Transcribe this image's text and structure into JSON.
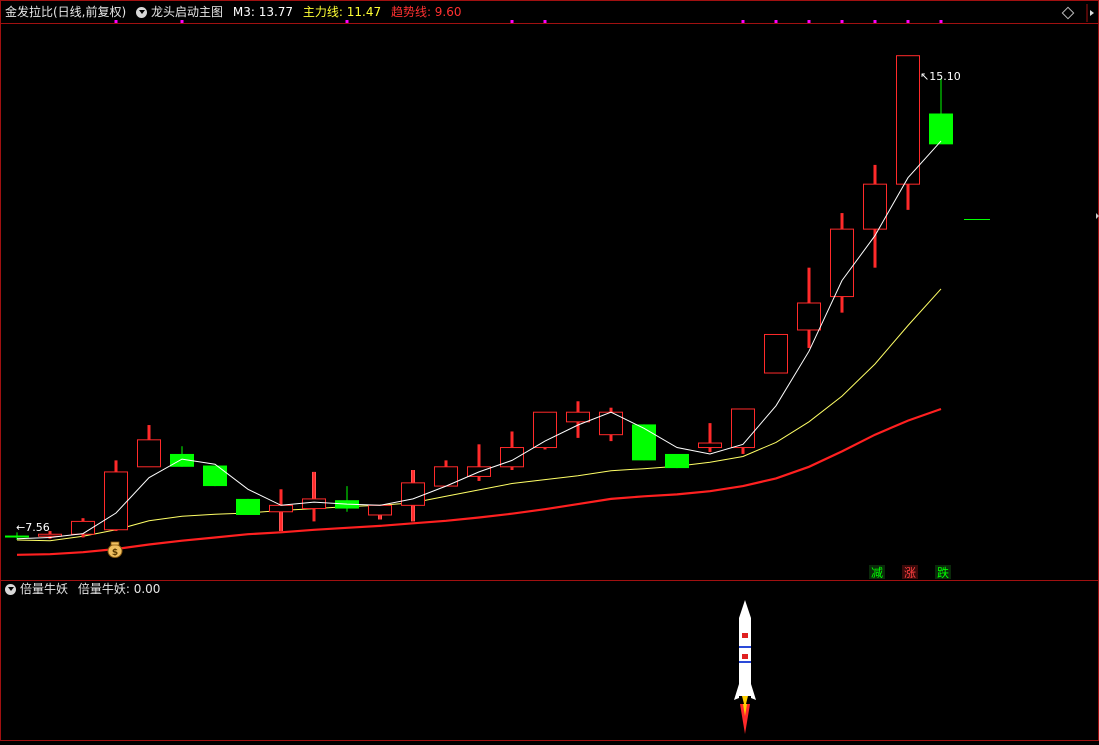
{
  "main_header": {
    "symbol": "金发拉比(日线,前复权)",
    "indicator_name": "龙头启动主图",
    "m3": "M3: 13.77",
    "main_line": "主力线: 11.47",
    "trend_line": "趋势线: 9.60"
  },
  "sub_header": {
    "indicator_name": "倍量牛妖",
    "value": "倍量牛妖: 0.00"
  },
  "markers": {
    "high": "15.10",
    "low": "7.56",
    "mark_minus": "减",
    "mark_up": "涨",
    "mark_down": "跌",
    "bag": "$"
  },
  "colors": {
    "background": "#000000",
    "border": "#a01010",
    "up": "#ff2a2a",
    "down": "#00ff00",
    "m3": "#ffffff",
    "main": "#ffff66",
    "trend": "#ff2020",
    "magenta": "#ff00ff",
    "pink": "#ff8080"
  },
  "chart_data": {
    "type": "candlestick",
    "ylim": [
      7.0,
      15.5
    ],
    "ohlc": [
      [
        7.63,
        7.68,
        7.56,
        7.6
      ],
      [
        7.62,
        7.7,
        7.58,
        7.65
      ],
      [
        7.65,
        7.9,
        7.6,
        7.85
      ],
      [
        7.72,
        8.8,
        7.7,
        8.62
      ],
      [
        8.7,
        9.35,
        8.7,
        9.12
      ],
      [
        8.9,
        9.02,
        8.7,
        8.7
      ],
      [
        8.72,
        8.72,
        8.4,
        8.4
      ],
      [
        8.2,
        8.2,
        7.95,
        7.95
      ],
      [
        8.0,
        8.35,
        7.7,
        8.1
      ],
      [
        8.05,
        8.62,
        7.85,
        8.2
      ],
      [
        8.18,
        8.4,
        8.0,
        8.05
      ],
      [
        7.95,
        8.1,
        7.88,
        8.1
      ],
      [
        8.1,
        8.65,
        7.85,
        8.45
      ],
      [
        8.4,
        8.8,
        8.4,
        8.7
      ],
      [
        8.55,
        9.05,
        8.48,
        8.7
      ],
      [
        8.7,
        9.25,
        8.65,
        9.0
      ],
      [
        9.0,
        9.55,
        8.97,
        9.55
      ],
      [
        9.4,
        9.72,
        9.15,
        9.55
      ],
      [
        9.2,
        9.62,
        9.1,
        9.55
      ],
      [
        9.36,
        9.36,
        8.8,
        8.8
      ],
      [
        8.9,
        8.9,
        8.68,
        8.68
      ],
      [
        9.0,
        9.38,
        8.93,
        9.07
      ],
      [
        9.0,
        9.6,
        8.9,
        9.6
      ],
      [
        10.16,
        10.16,
        10.16,
        10.76
      ],
      [
        10.83,
        11.8,
        10.55,
        11.25
      ],
      [
        11.35,
        12.65,
        11.1,
        12.4
      ],
      [
        12.4,
        13.4,
        11.8,
        13.1
      ],
      [
        13.1,
        15.05,
        12.7,
        15.1
      ],
      [
        14.2,
        14.75,
        14.2,
        13.72
      ]
    ],
    "m3": [
      7.58,
      7.6,
      7.66,
      7.98,
      8.53,
      8.82,
      8.74,
      8.35,
      8.1,
      8.15,
      8.12,
      8.1,
      8.2,
      8.4,
      8.62,
      8.8,
      9.1,
      9.35,
      9.55,
      9.3,
      9.0,
      8.9,
      9.05,
      9.65,
      10.5,
      11.6,
      12.3,
      13.2,
      13.77
    ],
    "main": [
      7.56,
      7.55,
      7.62,
      7.72,
      7.86,
      7.93,
      7.96,
      7.98,
      8.02,
      8.05,
      8.08,
      8.1,
      8.14,
      8.24,
      8.34,
      8.44,
      8.5,
      8.56,
      8.64,
      8.67,
      8.71,
      8.77,
      8.86,
      9.08,
      9.4,
      9.8,
      10.3,
      10.9,
      11.47
    ],
    "trend": [
      7.33,
      7.34,
      7.37,
      7.42,
      7.49,
      7.55,
      7.6,
      7.65,
      7.68,
      7.72,
      7.75,
      7.78,
      7.82,
      7.86,
      7.91,
      7.97,
      8.04,
      8.12,
      8.2,
      8.24,
      8.27,
      8.32,
      8.4,
      8.52,
      8.7,
      8.94,
      9.2,
      9.42,
      9.6
    ],
    "pink_bars": [
      {
        "index": 8,
        "high": 8.0,
        "low": 7.7
      },
      {
        "index": 9,
        "high": 8.62,
        "low": 8.05
      },
      {
        "index": 11,
        "high": 8.1,
        "low": 7.88
      },
      {
        "index": 12,
        "high": 8.65,
        "low": 7.85
      }
    ],
    "top_markers_index": [
      3,
      5,
      10,
      15,
      16,
      22,
      23,
      24,
      25,
      26,
      27,
      28
    ],
    "xlabel": "",
    "ylabel": ""
  }
}
